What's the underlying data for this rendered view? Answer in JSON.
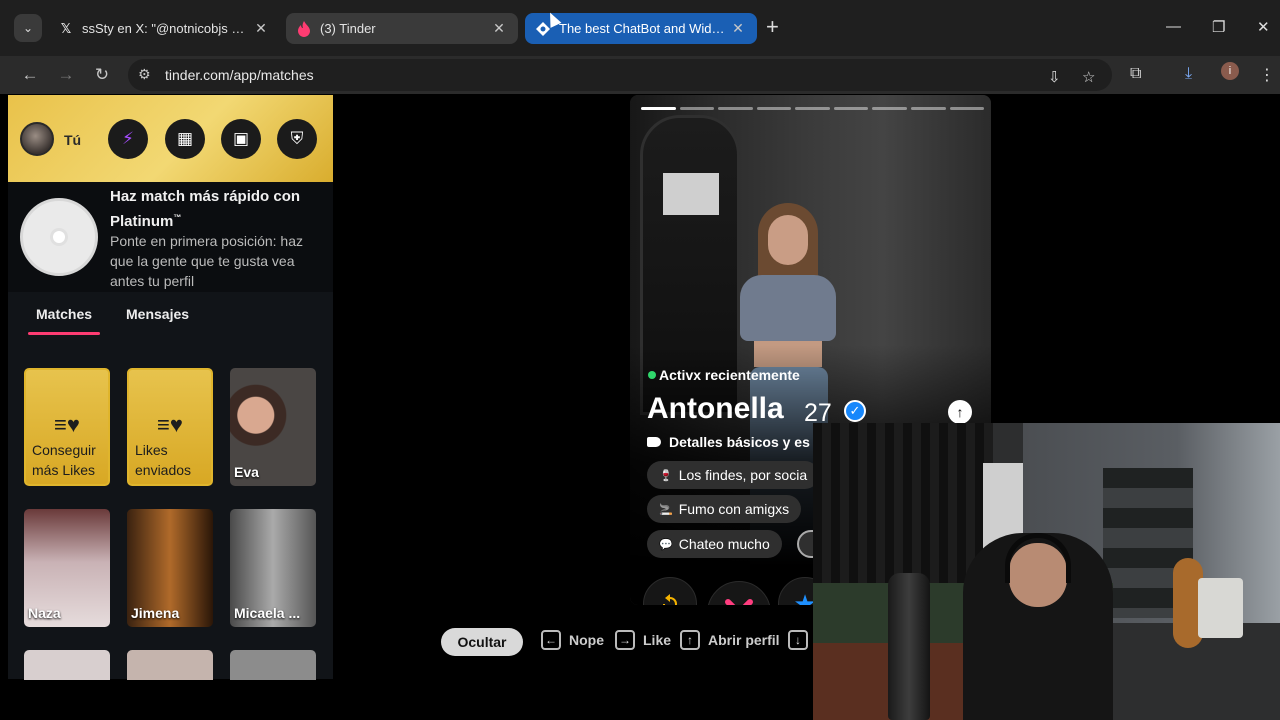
{
  "browser": {
    "tabs": [
      {
        "icon": "x-icon",
        "title": "ssSty en X: \"@notnicobjs Pero e",
        "state": "normal"
      },
      {
        "icon": "tinder-flame-icon",
        "title": "(3) Tinder",
        "state": "active"
      },
      {
        "icon": "chatbot-icon",
        "title": "The best ChatBot and Widgets",
        "state": "grouped"
      }
    ],
    "url": "tinder.com/app/matches",
    "profile_initial": "i"
  },
  "sidebar": {
    "me_label": "Tú",
    "promo": {
      "title": "Haz match más rápido con Platinum",
      "trademark": "™",
      "body": "Ponte en primera posición: haz que la gente que te gusta vea antes tu perfil"
    },
    "tabs": [
      {
        "label": "Matches",
        "active": true
      },
      {
        "label": "Mensajes",
        "active": false
      }
    ],
    "cards": [
      {
        "kind": "gold",
        "label": "Conseguir más Likes"
      },
      {
        "kind": "gold",
        "label": "Likes enviados"
      },
      {
        "kind": "photo",
        "name": "Eva"
      },
      {
        "kind": "photo",
        "name": "Naza"
      },
      {
        "kind": "photo",
        "name": "Jimena"
      },
      {
        "kind": "photo",
        "name": "Micaela ..."
      }
    ]
  },
  "profile": {
    "photo_count": 9,
    "current_photo": 1,
    "status": "Activx recientemente",
    "name": "Antonella",
    "age": "27",
    "details_label": "Detalles básicos y es",
    "chips": [
      "Los findes, por socia",
      "Fumo con amigxs",
      "Chateo mucho"
    ]
  },
  "hints": {
    "hide_label": "Ocultar",
    "nope": "Nope",
    "like": "Like",
    "open_profile": "Abrir perfil"
  },
  "colors": {
    "tinder_pink": "#fe3c72",
    "gold": "#e9c24a",
    "verified_blue": "#1787fb",
    "online_green": "#2fd66b"
  }
}
